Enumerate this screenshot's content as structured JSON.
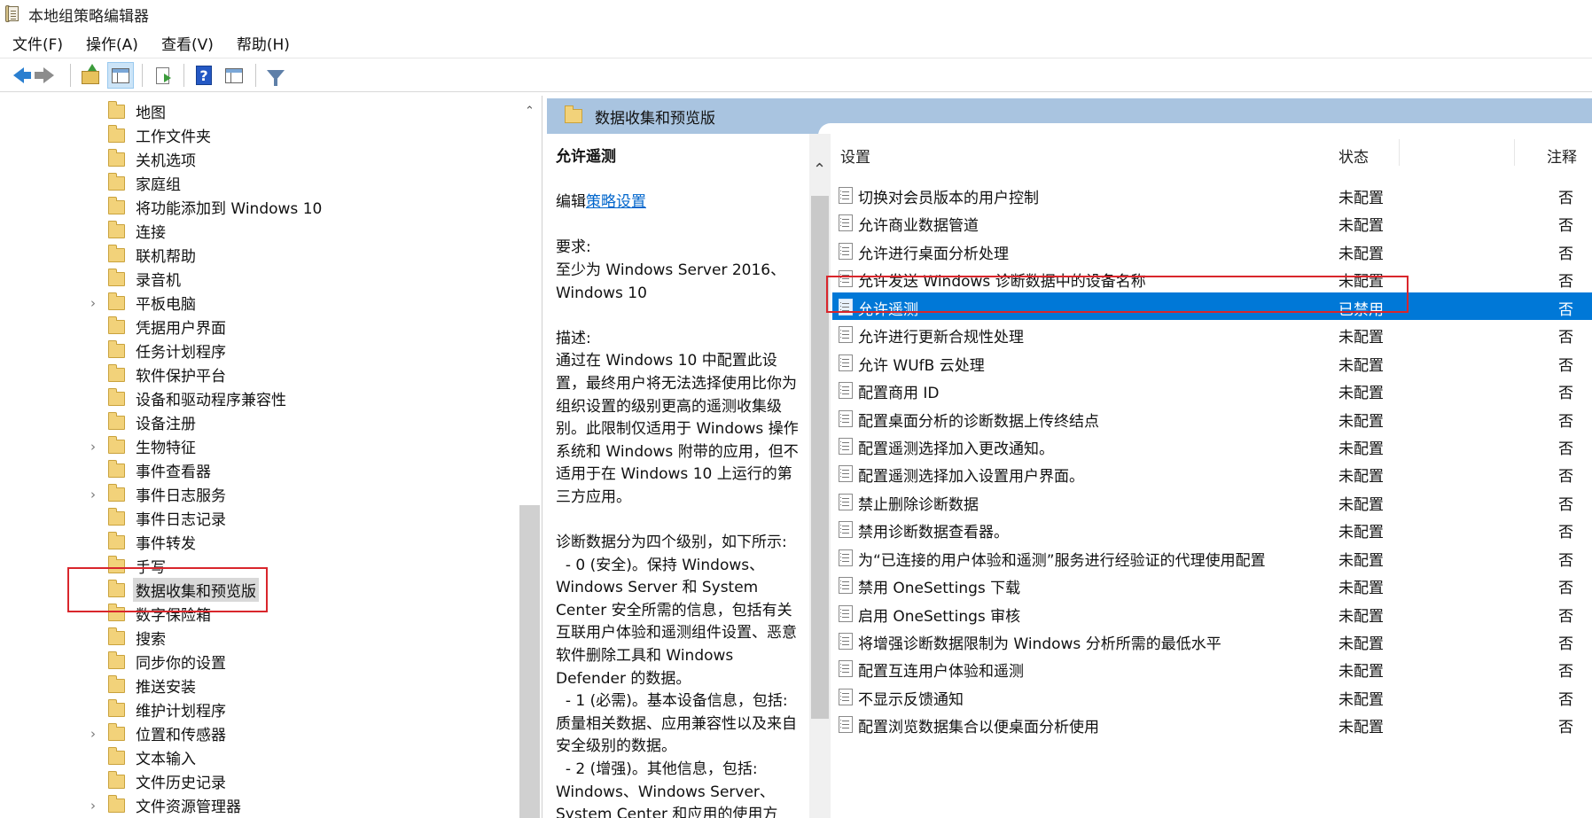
{
  "window": {
    "title": "本地组策略编辑器",
    "app_icon": "gpedit-icon"
  },
  "menu": [
    "文件(F)",
    "操作(A)",
    "查看(V)",
    "帮助(H)"
  ],
  "toolbar": {
    "buttons": [
      "back-arrow-icon",
      "forward-arrow-icon",
      "up-folder-icon",
      "show-hide-tree-icon",
      "export-list-icon",
      "help-icon",
      "properties-panel-icon",
      "filter-icon"
    ],
    "help_glyph": "?"
  },
  "tree": {
    "items": [
      {
        "label": "地图",
        "expandable": false
      },
      {
        "label": "工作文件夹",
        "expandable": false
      },
      {
        "label": "关机选项",
        "expandable": false
      },
      {
        "label": "家庭组",
        "expandable": false
      },
      {
        "label": "将功能添加到 Windows 10",
        "expandable": false
      },
      {
        "label": "连接",
        "expandable": false
      },
      {
        "label": "联机帮助",
        "expandable": false
      },
      {
        "label": "录音机",
        "expandable": false
      },
      {
        "label": "平板电脑",
        "expandable": true
      },
      {
        "label": "凭据用户界面",
        "expandable": false
      },
      {
        "label": "任务计划程序",
        "expandable": false
      },
      {
        "label": "软件保护平台",
        "expandable": false
      },
      {
        "label": "设备和驱动程序兼容性",
        "expandable": false
      },
      {
        "label": "设备注册",
        "expandable": false
      },
      {
        "label": "生物特征",
        "expandable": true
      },
      {
        "label": "事件查看器",
        "expandable": false
      },
      {
        "label": "事件日志服务",
        "expandable": true
      },
      {
        "label": "事件日志记录",
        "expandable": false
      },
      {
        "label": "事件转发",
        "expandable": false
      },
      {
        "label": "手写",
        "expandable": false
      },
      {
        "label": "数据收集和预览版",
        "expandable": false,
        "selected": true
      },
      {
        "label": "数字保险箱",
        "expandable": false
      },
      {
        "label": "搜索",
        "expandable": false
      },
      {
        "label": "同步你的设置",
        "expandable": false
      },
      {
        "label": "推送安装",
        "expandable": false
      },
      {
        "label": "维护计划程序",
        "expandable": false
      },
      {
        "label": "位置和传感器",
        "expandable": true
      },
      {
        "label": "文本输入",
        "expandable": false
      },
      {
        "label": "文件历史记录",
        "expandable": false
      },
      {
        "label": "文件资源管理器",
        "expandable": true
      }
    ],
    "expander_glyph": "›",
    "scroll_up_glyph": "⌃"
  },
  "right_header": {
    "title": "数据收集和预览版"
  },
  "description": {
    "policy_title": "允许遥测",
    "edit_prefix": "编辑",
    "edit_link": "策略设置",
    "requirement_label": "要求:",
    "requirement_text": "至少为 Windows Server 2016、Windows 10",
    "description_label": "描述:",
    "description_text": "通过在 Windows 10 中配置此设置，最终用户将无法选择使用比你为组织设置的级别更高的遥测收集级别。此限制仅适用于 Windows 操作系统和 Windows 附带的应用，但不适用于在 Windows 10 上运行的第三方应用。",
    "levels_intro": "诊断数据分为四个级别，如下所示:",
    "level0": "  - 0 (安全)。保持 Windows、Windows Server 和 System Center 安全所需的信息，包括有关互联用户体验和遥测组件设置、恶意软件删除工具和 Windows Defender 的数据。",
    "level1": "  - 1 (必需)。基本设备信息，包括: 质量相关数据、应用兼容性以及来自安全级别的数据。",
    "level2": "  - 2 (增强)。其他信息，包括: Windows、Windows Server、System Center 和应用的使用方",
    "scroll_up_glyph": "⌃"
  },
  "list": {
    "columns": {
      "setting": "设置",
      "state": "状态",
      "note": "注释"
    },
    "rows": [
      {
        "name": "切换对会员版本的用户控制",
        "state": "未配置",
        "note": "否"
      },
      {
        "name": "允许商业数据管道",
        "state": "未配置",
        "note": "否"
      },
      {
        "name": "允许进行桌面分析处理",
        "state": "未配置",
        "note": "否"
      },
      {
        "name": "允许发送 Windows 诊断数据中的设备名称",
        "state": "未配置",
        "note": "否"
      },
      {
        "name": "允许遥测",
        "state": "已禁用",
        "note": "否",
        "selected": true
      },
      {
        "name": "允许进行更新合规性处理",
        "state": "未配置",
        "note": "否"
      },
      {
        "name": "允许 WUfB 云处理",
        "state": "未配置",
        "note": "否"
      },
      {
        "name": "配置商用 ID",
        "state": "未配置",
        "note": "否"
      },
      {
        "name": "配置桌面分析的诊断数据上传终结点",
        "state": "未配置",
        "note": "否"
      },
      {
        "name": "配置遥测选择加入更改通知。",
        "state": "未配置",
        "note": "否"
      },
      {
        "name": "配置遥测选择加入设置用户界面。",
        "state": "未配置",
        "note": "否"
      },
      {
        "name": "禁止删除诊断数据",
        "state": "未配置",
        "note": "否"
      },
      {
        "name": "禁用诊断数据查看器。",
        "state": "未配置",
        "note": "否"
      },
      {
        "name": "为“已连接的用户体验和遥测”服务进行经验证的代理使用配置",
        "state": "未配置",
        "note": "否"
      },
      {
        "name": "禁用 OneSettings 下载",
        "state": "未配置",
        "note": "否"
      },
      {
        "name": "启用 OneSettings 审核",
        "state": "未配置",
        "note": "否"
      },
      {
        "name": "将增强诊断数据限制为 Windows 分析所需的最低水平",
        "state": "未配置",
        "note": "否"
      },
      {
        "name": "配置互连用户体验和遥测",
        "state": "未配置",
        "note": "否"
      },
      {
        "name": "不显示反馈通知",
        "state": "未配置",
        "note": "否"
      },
      {
        "name": "配置浏览数据集合以便桌面分析使用",
        "state": "未配置",
        "note": "否"
      }
    ]
  },
  "colors": {
    "selection": "#0078d7",
    "header_band": "#a9c4e0",
    "annotation": "#d9262c",
    "link": "#0066cc"
  }
}
